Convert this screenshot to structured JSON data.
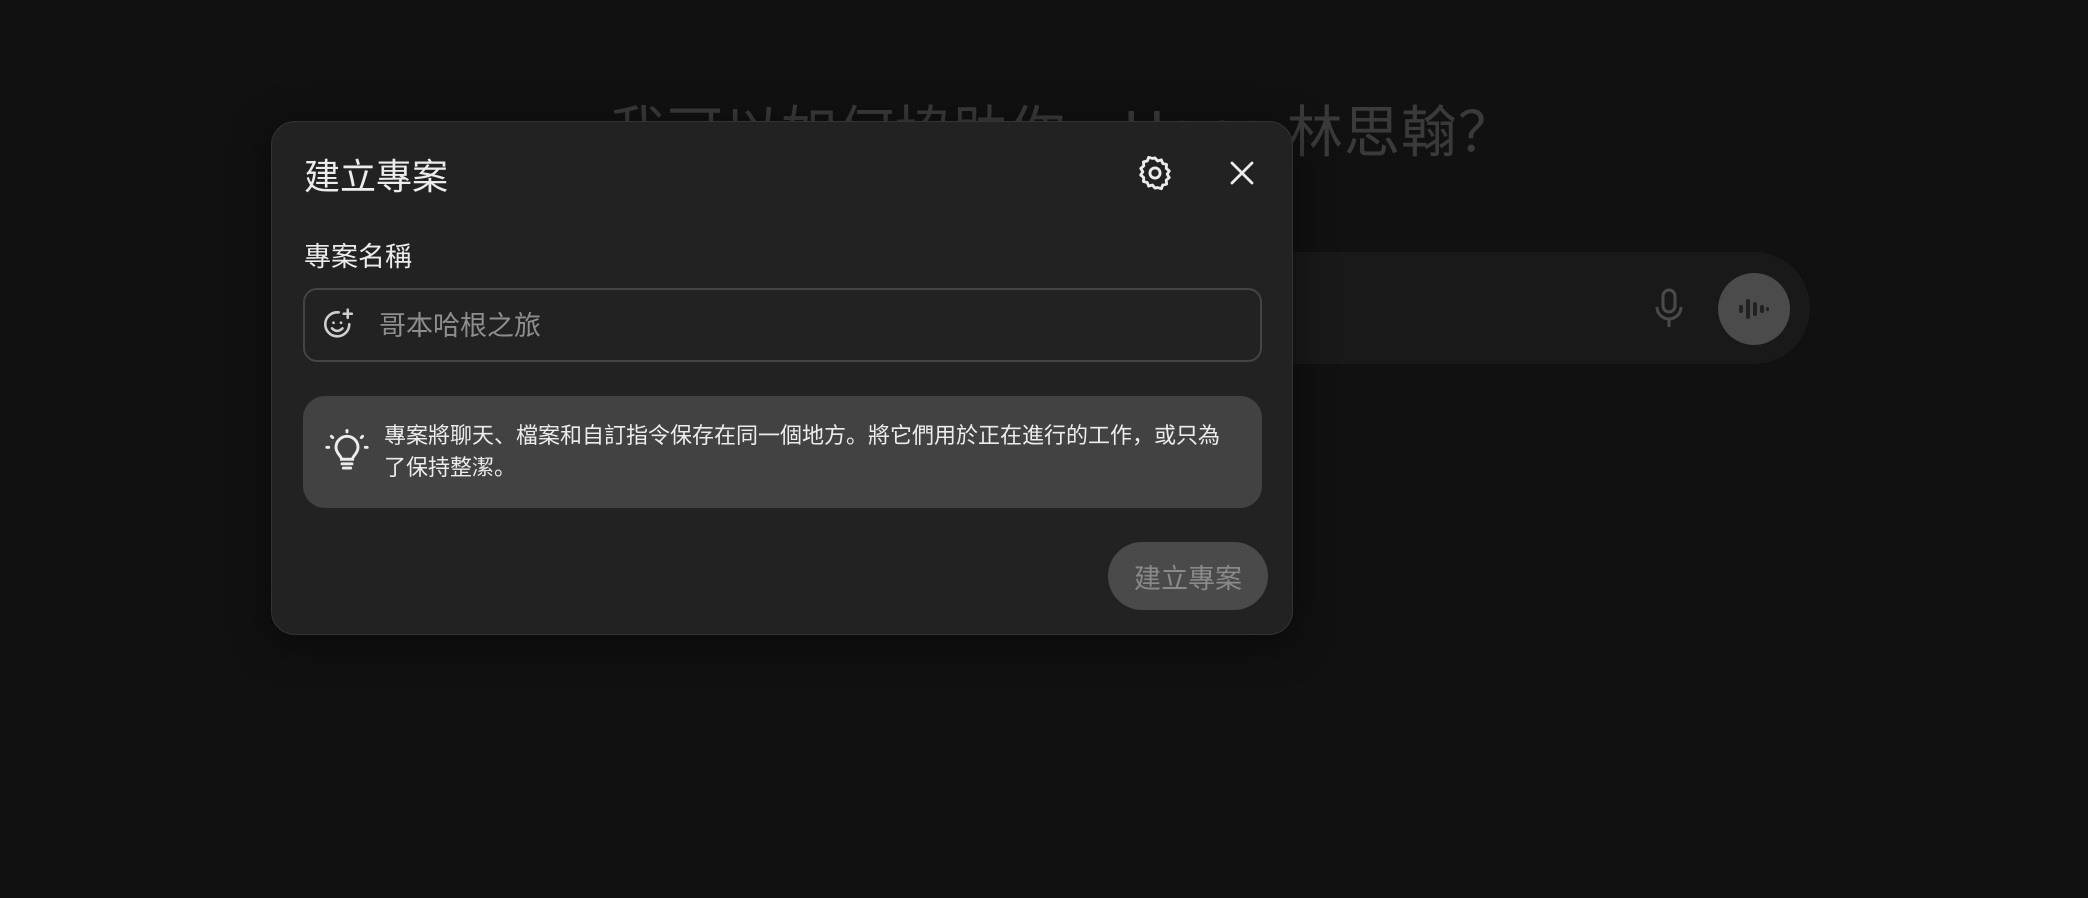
{
  "background": {
    "greeting": "我可以如何協助你，Hans 林思翰？"
  },
  "modal": {
    "title": "建立專案",
    "name_label": "專案名稱",
    "name_input": {
      "value": "",
      "placeholder": "哥本哈根之旅"
    },
    "tip_text": "專案將聊天、檔案和自訂指令保存在同一個地方。將它們用於正在進行的工作，或只為了保持整潔。",
    "create_button_label": "建立專案",
    "create_button_enabled": false
  },
  "icons": {
    "settings": "gear-icon",
    "close": "close-icon",
    "emoji": "add-emoji-icon",
    "tip": "lightbulb-icon",
    "mic": "microphone-icon",
    "voice": "voice-mode-icon"
  },
  "colors": {
    "page_bg": "#111111",
    "modal_bg": "#222222",
    "tip_bg": "#424242",
    "button_disabled_bg": "#4a4a4a",
    "text_primary": "#ececec"
  }
}
